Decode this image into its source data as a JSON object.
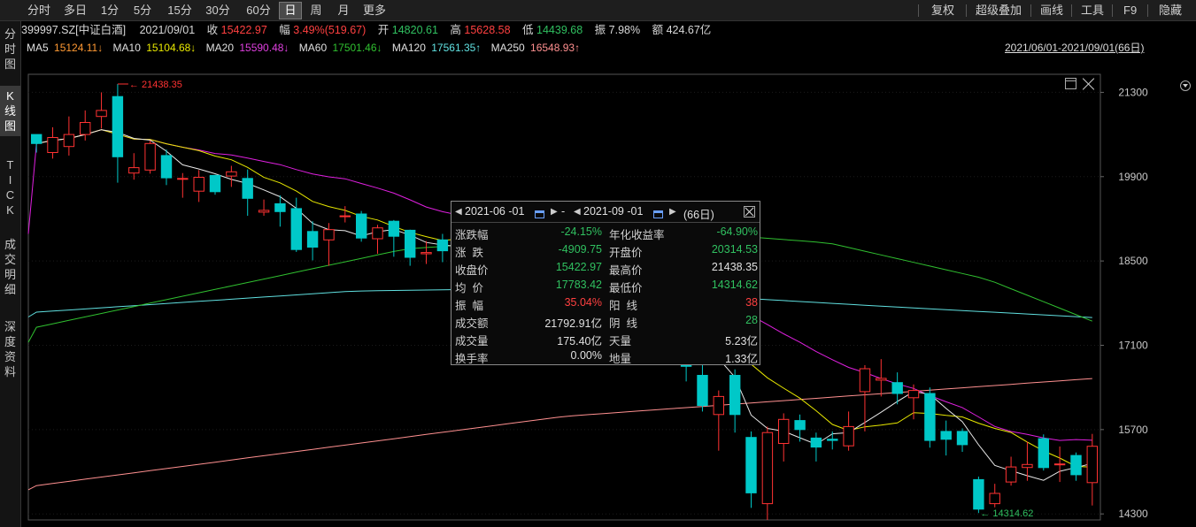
{
  "toolbar": {
    "tabs": [
      "分时",
      "多日",
      "1分",
      "5分",
      "15分",
      "30分",
      "60分",
      "日",
      "周",
      "月",
      "更多"
    ],
    "active_tab": "日",
    "right": [
      "复权",
      "超级叠加",
      "画线",
      "工具",
      "F9",
      "隐藏"
    ]
  },
  "sidebar": {
    "items": [
      "分\n时\n图",
      "K\n线\n图",
      "T\nI\nC\nK",
      "成\n交\n明\n细",
      "深\n度\n资\n料"
    ],
    "active": 1
  },
  "info": {
    "code": "399997.SZ[中证白酒]",
    "date": "2021/09/01",
    "close_label": "收",
    "close": "15422.97",
    "amp_label": "幅",
    "change": "3.49%(519.67)",
    "open_label": "开",
    "open": "14820.61",
    "high_label": "高",
    "high": "15628.58",
    "low_label": "低",
    "low": "14439.68",
    "swing_label": "振",
    "swing": "7.98%",
    "amount_label": "额",
    "amount": "424.67亿"
  },
  "ma": {
    "ma5_label": "MA5",
    "ma5": "15124.11↓",
    "ma10_label": "MA10",
    "ma10": "15104.68↓",
    "ma20_label": "MA20",
    "ma20": "15590.48↓",
    "ma60_label": "MA60",
    "ma60": "17501.46↓",
    "ma120_label": "MA120",
    "ma120": "17561.35↑",
    "ma250_label": "MA250",
    "ma250": "16548.93↑",
    "range": "2021/06/01-2021/09/01(66日)"
  },
  "colors": {
    "up": "#ff3232",
    "down": "#00c8c8",
    "ma5": "#e8e8e8",
    "ma10": "#e8e800",
    "ma20": "#e020e0",
    "ma60": "#30c030",
    "ma120": "#60e0e0",
    "ma250": "#ff9090",
    "up_text": "#ff4040",
    "down_text": "#30c060",
    "orange": "#ff9933"
  },
  "chart_data": {
    "type": "candlestick",
    "ylim": [
      14200,
      21600
    ],
    "yticks": [
      "21300",
      "19900",
      "18500",
      "17100",
      "15700",
      "14300"
    ],
    "max_label": "21438.35",
    "min_label": "14314.62",
    "candles": [
      [
        20600,
        20450,
        20600,
        20300
      ],
      [
        20300,
        20550,
        20720,
        20200
      ],
      [
        20400,
        20600,
        20900,
        20250
      ],
      [
        20600,
        20800,
        21000,
        20500
      ],
      [
        20900,
        21000,
        21300,
        20700
      ],
      [
        21230,
        20230,
        21438.35,
        19800
      ],
      [
        19960,
        20050,
        20290,
        19850
      ],
      [
        20010,
        20450,
        20500,
        19950
      ],
      [
        20250,
        19880,
        20350,
        19760
      ],
      [
        19860,
        19870,
        19960,
        19550
      ],
      [
        19660,
        19890,
        20010,
        19480
      ],
      [
        19920,
        19650,
        19930,
        19600
      ],
      [
        19910,
        19980,
        20080,
        19730
      ],
      [
        19870,
        19540,
        20020,
        19250
      ],
      [
        19310,
        19340,
        19520,
        19250
      ],
      [
        19450,
        19320,
        19590,
        19070
      ],
      [
        19370,
        18690,
        19550,
        18650
      ],
      [
        18990,
        18730,
        19160,
        18510
      ],
      [
        18850,
        19020,
        19130,
        18420
      ],
      [
        19240,
        19250,
        19410,
        19140
      ],
      [
        19280,
        18880,
        19330,
        18820
      ],
      [
        18870,
        19050,
        19100,
        18620
      ],
      [
        19160,
        18910,
        19180,
        18570
      ],
      [
        19010,
        18560,
        19020,
        18420
      ],
      [
        18620,
        18640,
        18830,
        18450
      ],
      [
        18850,
        18670,
        18950,
        18480
      ],
      [
        18770,
        18930,
        18990,
        18320
      ],
      [
        18520,
        18530,
        19500,
        18350
      ],
      [
        18520,
        18500,
        19150,
        18400
      ],
      [
        18200,
        18220,
        18700,
        18100
      ],
      [
        18150,
        18300,
        18650,
        18000
      ],
      [
        18300,
        18450,
        19200,
        18100
      ],
      [
        18250,
        18500,
        19500,
        18100
      ],
      [
        18000,
        18100,
        18800,
        17900
      ],
      [
        17800,
        17850,
        18500,
        17600
      ],
      [
        17800,
        17900,
        18300,
        17700
      ],
      [
        17500,
        17600,
        18000,
        17400
      ],
      [
        17300,
        17350,
        17800,
        17200
      ],
      [
        17400,
        17500,
        17900,
        17300
      ],
      [
        17500,
        17800,
        17900,
        17400
      ],
      [
        16800,
        16750,
        17000,
        16500
      ],
      [
        16600,
        16100,
        17350,
        16000
      ],
      [
        15950,
        16250,
        16350,
        15350
      ],
      [
        16600,
        15950,
        16700,
        15650
      ],
      [
        15570,
        14650,
        15670,
        14400
      ],
      [
        14470,
        15650,
        15750,
        14200
      ],
      [
        15470,
        15870,
        15970,
        15170
      ],
      [
        15850,
        15700,
        15950,
        15500
      ],
      [
        15560,
        15410,
        15650,
        15170
      ],
      [
        15540,
        15520,
        15670,
        15370
      ],
      [
        15430,
        15750,
        16000,
        15350
      ],
      [
        16330,
        16710,
        16770,
        15670
      ],
      [
        16520,
        16550,
        16870,
        16250
      ],
      [
        16480,
        16300,
        16650,
        16120
      ],
      [
        16230,
        16350,
        16450,
        15870
      ],
      [
        16300,
        15520,
        16400,
        15400
      ],
      [
        15670,
        15540,
        15850,
        15270
      ],
      [
        15670,
        15450,
        15720,
        15330
      ],
      [
        14870,
        14380,
        14920,
        14314.62
      ],
      [
        14470,
        14640,
        14800,
        14410
      ],
      [
        14830,
        15080,
        15250,
        14770
      ],
      [
        15070,
        15120,
        15500,
        14850
      ],
      [
        15550,
        15070,
        15620,
        15020
      ],
      [
        15120,
        15130,
        15420,
        14830
      ],
      [
        15270,
        14950,
        15320,
        14850
      ],
      [
        14820,
        15422.97,
        15628.58,
        14439.68
      ]
    ]
  },
  "tooltip": {
    "start": "2021-06 -01",
    "dash": "-",
    "end": "2021-09 -01",
    "days": "(66日)",
    "rows": [
      [
        "涨跌幅",
        "-24.15%",
        "年化收益率",
        "-64.90%"
      ],
      [
        "涨  跌",
        "-4909.75",
        "开盘价",
        "20314.53"
      ],
      [
        "收盘价",
        "15422.97",
        "最高价",
        "21438.35"
      ],
      [
        "均  价",
        "17783.42",
        "最低价",
        "14314.62"
      ],
      [
        "振  幅",
        "35.04%",
        "阳  线",
        "38"
      ],
      [
        "成交额",
        "21792.91亿",
        "阴  线",
        "28"
      ],
      [
        "成交量",
        "175.40亿",
        "天量",
        "5.23亿"
      ],
      [
        "换手率",
        "0.00%",
        "地量",
        "1.33亿"
      ]
    ],
    "row_colors": [
      [
        "#30c060",
        "#30c060"
      ],
      [
        "#30c060",
        "#30c060"
      ],
      [
        "#30c060",
        "#e0e0e0"
      ],
      [
        "#30c060",
        "#30c060"
      ],
      [
        "#ff4040",
        "#ff4040"
      ],
      [
        "#e0e0e0",
        "#30c060"
      ],
      [
        "#e0e0e0",
        "#e0e0e0"
      ],
      [
        "#e0e0e0",
        "#e0e0e0"
      ]
    ]
  }
}
